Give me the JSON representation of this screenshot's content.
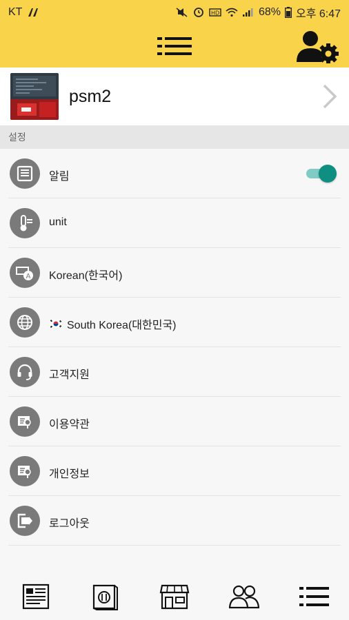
{
  "status_bar": {
    "carrier": "KT",
    "battery": "68%",
    "time": "오후 6:47"
  },
  "header": {
    "menu_icon": "hamburger-menu-icon",
    "user_settings_icon": "user-gear-icon",
    "background_color": "#f9d34a"
  },
  "profile": {
    "name": "psm2"
  },
  "section": {
    "title": "설정"
  },
  "settings": [
    {
      "icon": "notification-icon",
      "label": "알림",
      "toggle": true
    },
    {
      "icon": "thermometer-icon",
      "label": "unit"
    },
    {
      "icon": "language-icon",
      "label": "Korean(한국어)"
    },
    {
      "icon": "globe-icon",
      "label": "South Korea(대한민국)",
      "flag": "south-korea-flag-icon"
    },
    {
      "icon": "headset-icon",
      "label": "고객지원"
    },
    {
      "icon": "document-icon",
      "label": "이용약관"
    },
    {
      "icon": "document-icon",
      "label": "개인정보"
    },
    {
      "icon": "logout-icon",
      "label": "로그아웃"
    }
  ],
  "toggle": {
    "on": true,
    "color": "#0f8f82"
  },
  "bottom_nav": [
    {
      "icon": "news-icon"
    },
    {
      "icon": "recipe-book-icon"
    },
    {
      "icon": "store-icon"
    },
    {
      "icon": "community-icon"
    },
    {
      "icon": "hamburger-menu-icon",
      "active": true
    }
  ]
}
